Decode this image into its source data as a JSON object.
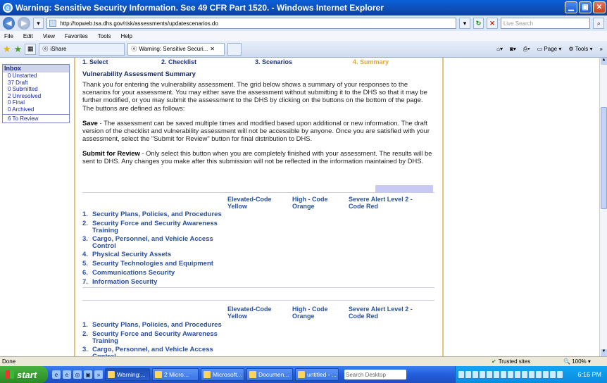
{
  "window": {
    "title": "Warning: Sensitive Security Information. See 49 CFR Part 1520. - Windows Internet Explorer"
  },
  "address": {
    "url": "http://topweb.tsa.dhs.gov/risk/assessments/updatescenarios.do",
    "search_placeholder": "Live Search"
  },
  "menu": [
    "File",
    "Edit",
    "View",
    "Favorites",
    "Tools",
    "Help"
  ],
  "tabs": [
    {
      "label": "iShare"
    },
    {
      "label": "Warning: Sensitive Securi..."
    }
  ],
  "commands": {
    "page": "Page",
    "tools": "Tools"
  },
  "inbox": {
    "title": "Inbox",
    "items": [
      "0 Unstarted",
      "37 Draft",
      "0 Submitted",
      "2 Unresolved",
      "0 Final",
      "0 Archived"
    ],
    "review": "6 To Review"
  },
  "steps": [
    "1. Select",
    "2. Checklist",
    "3. Scenarios",
    "4. Summary"
  ],
  "summary": {
    "title": "Vulnerability Assessment Summary",
    "intro": "Thank you for entering the vulnerability assessment. The grid below shows a summary of your responses to the scenarios for your assessment. You may either save the assessment without submitting it to the DHS so that it may be further modified, or you may submit the assessment to the DHS by clicking on the buttons on the bottom of the page. The buttons are defined as follows:",
    "save_term": "Save",
    "save_text": " - The assessment can be saved multiple times and modified based upon additional or new information. The draft version of the checklist and vulnerability assessment will not be accessible by anyone. Once you are satisfied with your assessment, select the \"Submit for Review\" button for final distribution to DHS.",
    "submit_term": "Submit for Review",
    "submit_text": " - Only select this button when you are completely finished with your assessment. The results will be sent to DHS. Any changes you make after this submission will not be reflected in the information maintained by DHS."
  },
  "grid": {
    "columns": [
      "Elevated-Code Yellow",
      "High - Code Orange",
      "Severe Alert Level 2 - Code Red"
    ],
    "categories": [
      "Security Plans, Policies, and Procedures",
      "Security Force and Security Awareness Training",
      "Cargo, Personnel, and Vehicle Access Control",
      "Physical Security Assets",
      "Security Technologies and Equipment",
      "Communications Security",
      "Information Security"
    ],
    "numbers": [
      "1.",
      "2.",
      "3.",
      "4.",
      "5.",
      "6.",
      "7."
    ]
  },
  "status": {
    "left": "Done",
    "zone": "Trusted sites",
    "zoom": "100%"
  },
  "taskbar": {
    "start": "start",
    "buttons": [
      "Warning:...",
      "2 Micro...",
      "Microsoft...",
      "Documen...",
      "untitled - ..."
    ],
    "search": "Search Desktop",
    "clock": "6:16 PM"
  }
}
